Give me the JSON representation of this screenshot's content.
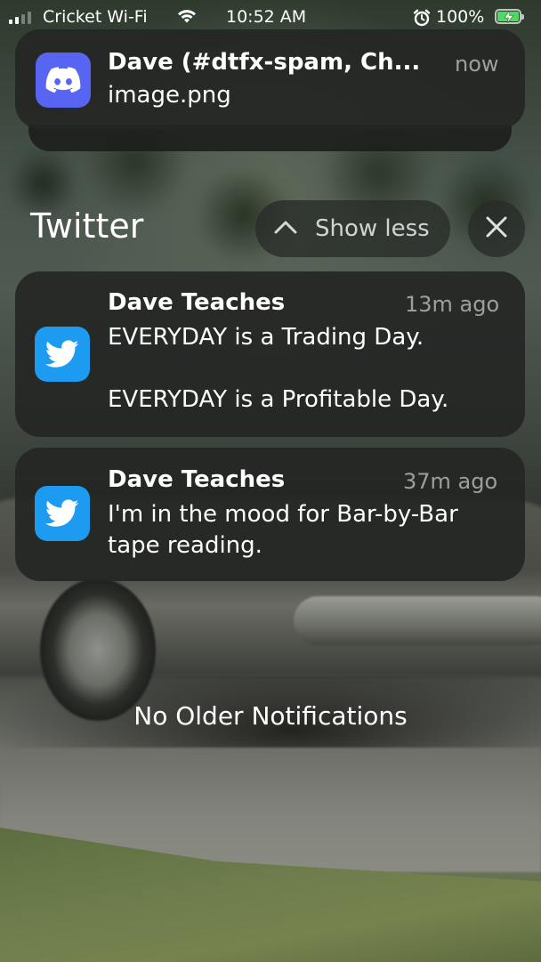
{
  "status_bar": {
    "carrier": "Cricket Wi-Fi",
    "time": "10:52 AM",
    "battery_percent": "100%",
    "signal_bars_active": 2,
    "charging": true,
    "icons": [
      "signal-icon",
      "wifi-icon",
      "alarm-icon",
      "battery-charging-icon"
    ]
  },
  "discord_notification": {
    "app_icon": "discord-icon",
    "title": "Dave (#dtfx-spam, Ch...",
    "time": "now",
    "body": "image.png"
  },
  "twitter_group": {
    "title": "Twitter",
    "show_less_label": "Show less",
    "close_icon": "close-icon",
    "notifications": [
      {
        "app_icon": "twitter-icon",
        "title": "Dave Teaches",
        "time": "13m ago",
        "body": "EVERYDAY is a Trading Day.\n\nEVERYDAY is a Profitable Day."
      },
      {
        "app_icon": "twitter-icon",
        "title": "Dave Teaches",
        "time": "37m ago",
        "body": "I'm in the mood for Bar-by-Bar\ntape reading."
      }
    ]
  },
  "footer": {
    "no_older": "No Older Notifications"
  },
  "colors": {
    "discord": "#5865f2",
    "twitter": "#1d9bf0",
    "battery_charging": "#4cd964"
  }
}
